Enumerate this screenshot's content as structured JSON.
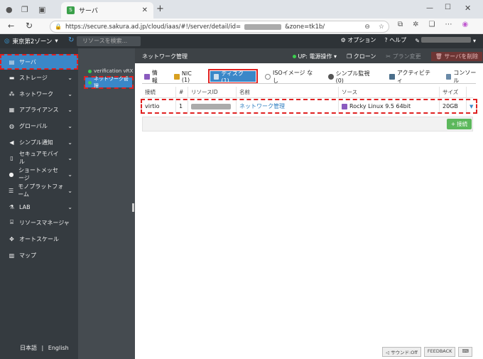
{
  "browser": {
    "tab_title": "サーバ",
    "url": "https://secure.sakura.ad.jp/cloud/iaas/#!/server/detail/id=",
    "url_suffix": "&zone=tk1b/"
  },
  "header": {
    "zone": "東京第2ゾーン",
    "search_placeholder": "リソースを検索...",
    "options": "オプション",
    "help": "ヘルプ"
  },
  "sidebar": {
    "items": [
      {
        "label": "サーバ"
      },
      {
        "label": "ストレージ"
      },
      {
        "label": "ネットワーク"
      },
      {
        "label": "アプライアンス"
      },
      {
        "label": "グローバル"
      },
      {
        "label": "シンプル通知"
      },
      {
        "label": "セキュアモバイル"
      },
      {
        "label": "ショートメッセージ"
      },
      {
        "label": "モノプラットフォーム"
      },
      {
        "label": "LAB"
      },
      {
        "label": "リソースマネージャ"
      },
      {
        "label": "オートスケール"
      },
      {
        "label": "マップ"
      }
    ],
    "lang_ja": "日本語",
    "lang_sep": "|",
    "lang_en": "English"
  },
  "tree": {
    "item1": "verification vRX",
    "item2": "ネットワーク管理"
  },
  "content": {
    "title": "ネットワーク管理",
    "status": "UP: 電源操作",
    "clone": "クローン",
    "plan_change": "プラン変更",
    "delete": "サーバを削除",
    "tabs": [
      {
        "label": "情報"
      },
      {
        "label": "NIC (1)"
      },
      {
        "label": "ディスク (1)"
      },
      {
        "label": "ISOイメージ なし"
      },
      {
        "label": "シンプル監視 (0)"
      },
      {
        "label": "アクティビティ"
      },
      {
        "label": "コンソール"
      }
    ],
    "columns": [
      "接続",
      "#",
      "リソースID",
      "名前",
      "ソース",
      "サイズ"
    ],
    "row": {
      "conn": "virtio",
      "num": "1",
      "name": "ネットワーク管理",
      "source": "Rocky Linux 9.5 64bit",
      "size": "20GB"
    },
    "connect_btn": "接続",
    "sound": "サウンド:Off",
    "feedback": "FEEDBACK"
  },
  "colors": {
    "accent": "#3a87c8",
    "highlight": "#e02020",
    "ok": "#3ccf4e"
  }
}
